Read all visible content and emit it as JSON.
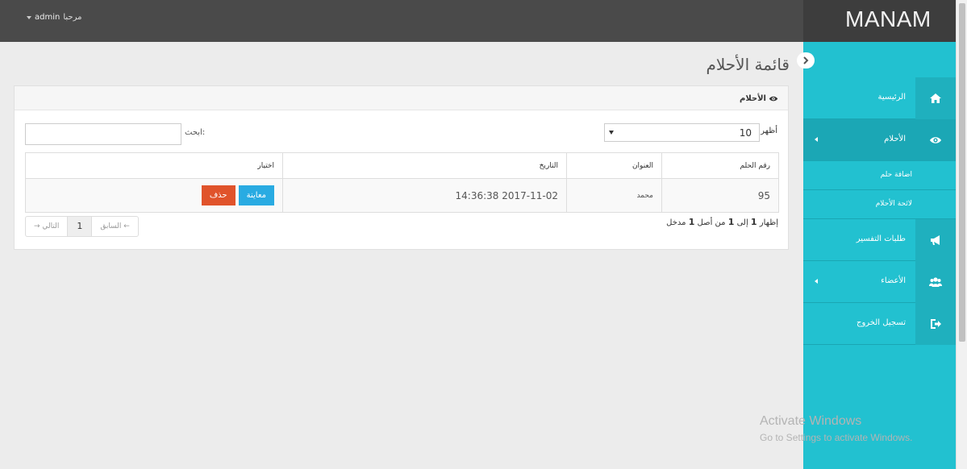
{
  "header": {
    "greeting": "مرحبا",
    "username": "admin"
  },
  "brand": {
    "name": "MANAM"
  },
  "sidebar": {
    "items": [
      {
        "label": "الرئيسية",
        "icon": "home-icon"
      },
      {
        "label": "الأحلام",
        "icon": "eye-icon",
        "active": true,
        "has_submenu": true
      },
      {
        "label": "اضافة حلم"
      },
      {
        "label": "لائحة الأحلام"
      },
      {
        "label": "طلبات التفسير",
        "icon": "megaphone-icon"
      },
      {
        "label": "الأعضاء",
        "icon": "users-icon",
        "has_submenu": true
      },
      {
        "label": "تسجيل الخروج",
        "icon": "sign-out-icon"
      }
    ]
  },
  "page": {
    "title": "قائمة الأحلام"
  },
  "panel": {
    "title": "الأحلام",
    "show_label": "أظهر",
    "length_value": "10",
    "search_label": "ابحث:",
    "search_value": ""
  },
  "table": {
    "columns": [
      "رقم الحلم",
      "العنوان",
      "التاريخ",
      "اختيار"
    ],
    "rows": [
      {
        "id": "95",
        "title": "محمد",
        "date": "2017-11-02 14:36:38",
        "view_label": "معاينة",
        "delete_label": "حذف"
      }
    ]
  },
  "footer": {
    "info_prefix": "إظهار",
    "info_from": "1",
    "info_to_word": "إلى",
    "info_to": "1",
    "info_of_word": "من أصل",
    "info_total": "1",
    "info_suffix": "مدخل",
    "prev_label": "← السابق",
    "current_page": "1",
    "next_label": "التالي →"
  },
  "watermark": {
    "line1": "Activate Windows",
    "line2": "Go to Settings to activate Windows."
  },
  "colors": {
    "sidebar": "#22c1d0",
    "topbar": "#4a4a4a",
    "view_button": "#29abe2",
    "delete_button": "#e0532b"
  }
}
